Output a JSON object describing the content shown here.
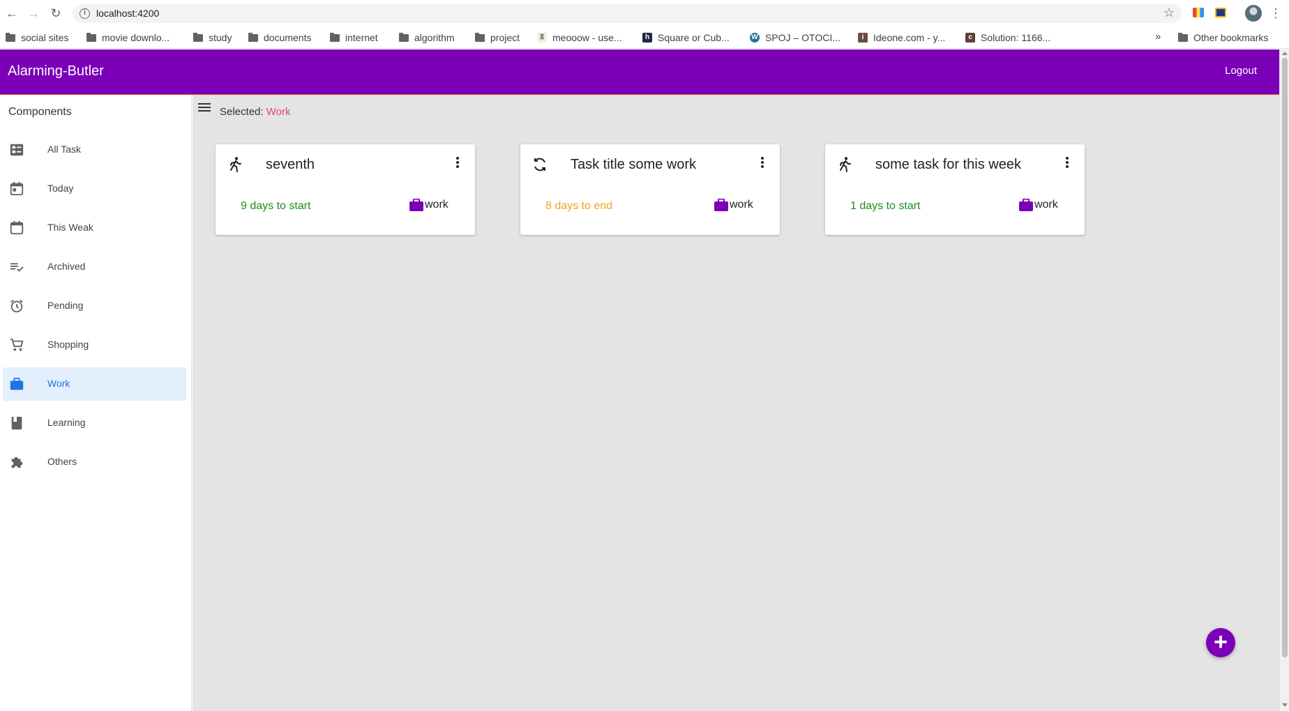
{
  "browser": {
    "url": "localhost:4200",
    "bookmarks": [
      {
        "label": "social sites",
        "type": "folder"
      },
      {
        "label": "movie downlo...",
        "type": "folder"
      },
      {
        "label": "study",
        "type": "folder"
      },
      {
        "label": "documents",
        "type": "folder"
      },
      {
        "label": "internet",
        "type": "folder"
      },
      {
        "label": "algorithm",
        "type": "folder"
      },
      {
        "label": "project",
        "type": "folder"
      },
      {
        "label": "meooow - use...",
        "type": "site"
      },
      {
        "label": "Square or Cub...",
        "type": "site"
      },
      {
        "label": "SPOJ – OTOCI...",
        "type": "site"
      },
      {
        "label": "Ideone.com - y...",
        "type": "site"
      },
      {
        "label": "Solution: 1166...",
        "type": "site"
      }
    ],
    "more": "»",
    "other_bookmarks": "Other bookmarks"
  },
  "header": {
    "title": "Alarming-Butler",
    "logout": "Logout",
    "color": "#7b00b8"
  },
  "sidebar": {
    "heading": "Components",
    "items": [
      {
        "label": "All Task",
        "icon": "checklist-icon",
        "active": false
      },
      {
        "label": "Today",
        "icon": "calendar-today-icon",
        "active": false
      },
      {
        "label": "This Weak",
        "icon": "calendar-icon",
        "active": false
      },
      {
        "label": "Archived",
        "icon": "playlist-check-icon",
        "active": false
      },
      {
        "label": "Pending",
        "icon": "alarm-icon",
        "active": false
      },
      {
        "label": "Shopping",
        "icon": "cart-icon",
        "active": false
      },
      {
        "label": "Work",
        "icon": "briefcase-icon",
        "active": true
      },
      {
        "label": "Learning",
        "icon": "book-icon",
        "active": false
      },
      {
        "label": "Others",
        "icon": "puzzle-icon",
        "active": false
      }
    ]
  },
  "main": {
    "selected_label": "Selected:",
    "selected_value": "Work",
    "cards": [
      {
        "title": "seventh",
        "type_icon": "walking-icon",
        "status": "9 days to start",
        "status_color": "green",
        "tag": "work"
      },
      {
        "title": "Task title some work",
        "type_icon": "repeat-icon",
        "status": "8 days to end",
        "status_color": "orange",
        "tag": "work"
      },
      {
        "title": "some task for this week",
        "type_icon": "walking-icon",
        "status": "1 days to start",
        "status_color": "green",
        "tag": "work"
      }
    ],
    "fab_label": "+"
  }
}
